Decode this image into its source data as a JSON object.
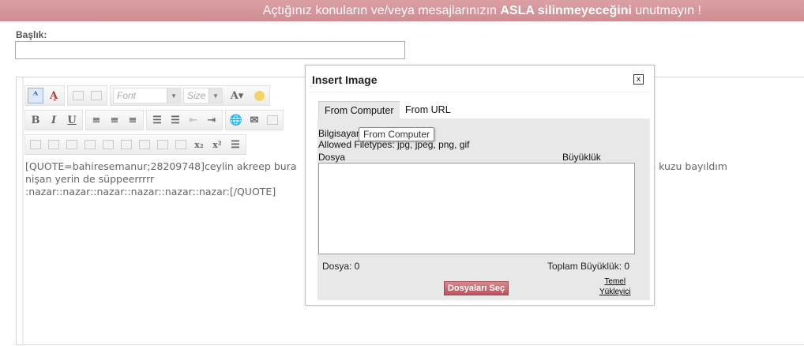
{
  "banner": {
    "text_before": "Açtığınız konuların ve/veya mesajlarınızın ",
    "text_bold": "ASLA silinmeyeceğini",
    "text_after": " unutmayın !"
  },
  "title_field": {
    "label": "Başlık:",
    "value": ""
  },
  "editor": {
    "toolbar": {
      "font_placeholder": "Font",
      "size_placeholder": "Size",
      "subscript": "x₂",
      "superscript": "x²"
    },
    "content": {
      "line1": "[QUOTE=bahiresemanur;28209748]ceylin akreep bura",
      "line1_tail": "m kuzu bayıldım",
      "line2": "nişan yerin de süppeerrrrr",
      "line3": ":nazar::nazar::nazar::nazar::nazar::nazar:[/QUOTE]"
    }
  },
  "dialog": {
    "title": "Insert Image",
    "close": "x",
    "tabs": [
      "From Computer",
      "From URL"
    ],
    "source_label": "Bilgisayar",
    "allowed_filetypes": "Allowed Filetypes: jpg, jpeg, png, gif",
    "tooltip": "From Computer",
    "columns": {
      "file": "Dosya",
      "size": "Büyüklük"
    },
    "footer": {
      "file_count": "Dosya: 0",
      "total_size": "Toplam Büyüklük: 0"
    },
    "select_files_button": "Dosyaları Seç",
    "basic_uploader_line1": "Temel",
    "basic_uploader_line2": "Yükleyici"
  },
  "colors": {
    "banner": "#d4959a",
    "button": "#c0616a"
  }
}
